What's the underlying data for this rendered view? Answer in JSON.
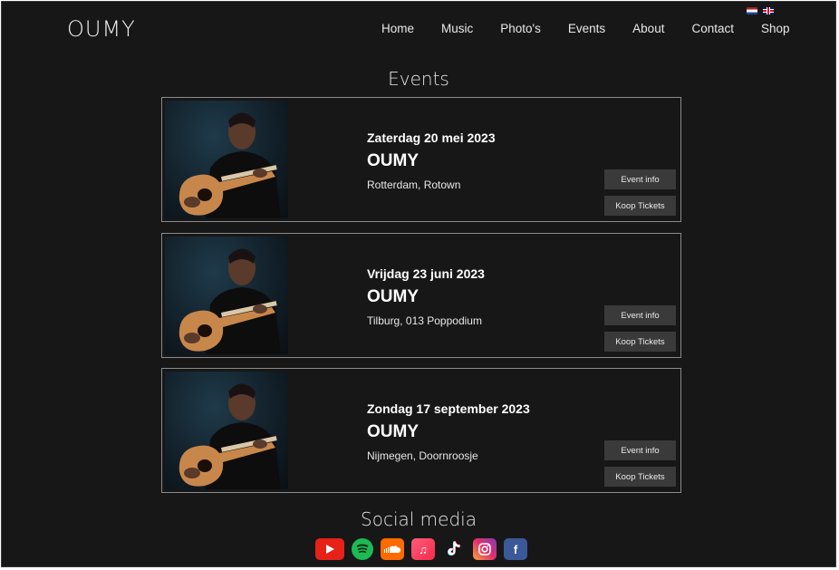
{
  "header": {
    "logo": "OUMY",
    "nav": [
      "Home",
      "Music",
      "Photo's",
      "Events",
      "About",
      "Contact",
      "Shop"
    ],
    "languages": [
      "nl-flag",
      "uk-flag"
    ]
  },
  "events_section": {
    "title": "Events",
    "events": [
      {
        "date": "Zaterdag 20 mei 2023",
        "artist": "OUMY",
        "venue": "Rotterdam, Rotown",
        "info_label": "Event info",
        "tickets_label": "Koop Tickets"
      },
      {
        "date": "Vrijdag 23 juni 2023",
        "artist": "OUMY",
        "venue": "Tilburg, 013 Poppodium",
        "info_label": "Event info",
        "tickets_label": "Koop Tickets"
      },
      {
        "date": "Zondag 17 september 2023",
        "artist": "OUMY",
        "venue": "Nijmegen, Doornroosje",
        "info_label": "Event info",
        "tickets_label": "Koop Tickets"
      }
    ]
  },
  "social": {
    "title": "Social media",
    "icons": [
      "youtube-icon",
      "spotify-icon",
      "soundcloud-icon",
      "apple-music-icon",
      "tiktok-icon",
      "instagram-icon",
      "facebook-icon"
    ]
  },
  "colors": {
    "background": "#171717",
    "button": "#3a3a3a",
    "card_border": "#8a8a8a"
  }
}
